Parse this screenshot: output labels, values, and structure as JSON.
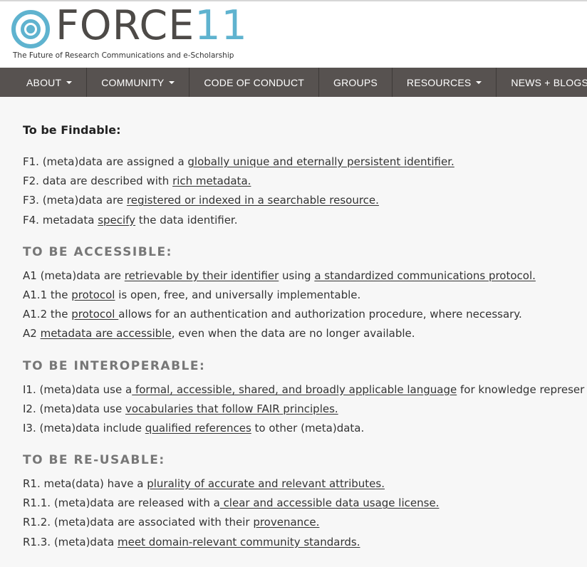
{
  "logo": {
    "word": "FORCE",
    "number": "11",
    "tagline": "The Future of Research Communications and e-Scholarship",
    "colors": {
      "ring": "#5fb3cf",
      "text": "#4d4a47"
    }
  },
  "nav": {
    "background": "#575250",
    "items": [
      {
        "label": "ABOUT",
        "dropdown": true
      },
      {
        "label": "COMMUNITY",
        "dropdown": true
      },
      {
        "label": "CODE OF CONDUCT",
        "dropdown": false
      },
      {
        "label": "GROUPS",
        "dropdown": false
      },
      {
        "label": "RESOURCES",
        "dropdown": true
      },
      {
        "label": "NEWS + BLOGS",
        "dropdown": true
      }
    ]
  },
  "content": {
    "findable": {
      "title": "To be Findable:",
      "lines": [
        {
          "prefix": "F1. (meta)data are assigned a ",
          "link": "globally unique and eternally persistent identifier.",
          "suffix": ""
        },
        {
          "prefix": "F2. data are described with ",
          "link": "rich metadata.",
          "suffix": ""
        },
        {
          "prefix": "F3. (meta)data are ",
          "link": "registered or indexed in a searchable resource.",
          "suffix": ""
        },
        {
          "prefix": "F4. metadata ",
          "link": "specify",
          "suffix": " the data identifier."
        }
      ]
    },
    "accessible": {
      "title": "TO BE ACCESSIBLE:",
      "lines": [
        {
          "prefix": "A1  (meta)data are ",
          "link": "retrievable by their identifier",
          "mid": " using ",
          "link2": "a standardized communications protocol.",
          "suffix": ""
        },
        {
          "prefix": "A1.1 the ",
          "link": "protocol",
          "suffix": " is open, free, and universally implementable."
        },
        {
          "prefix": "A1.2 the ",
          "link": "protocol ",
          "suffix": "allows for an authentication and authorization procedure, where necessary."
        },
        {
          "prefix": "A2 ",
          "link": "metadata are accessible",
          "suffix": ", even when the data are no longer available."
        }
      ]
    },
    "interoperable": {
      "title": "TO BE INTEROPERABLE:",
      "lines": [
        {
          "prefix": "I1. (meta)data use a",
          "link": " formal, accessible, shared, and broadly applicable language",
          "suffix": " for knowledge represer"
        },
        {
          "prefix": "I2. (meta)data use ",
          "link": "vocabularies that follow FAIR principles.",
          "suffix": ""
        },
        {
          "prefix": "I3. (meta)data include ",
          "link": "qualified references",
          "suffix": " to other (meta)data."
        }
      ]
    },
    "reusable": {
      "title": "TO BE RE-USABLE:",
      "lines": [
        {
          "prefix": "R1. meta(data) have a ",
          "link": "plurality of accurate and relevant attributes.",
          "suffix": ""
        },
        {
          "prefix": "R1.1. (meta)data are released with a",
          "link": " clear and accessible data usage license.",
          "suffix": ""
        },
        {
          "prefix": "R1.2. (meta)data are associated with their ",
          "link": "provenance.",
          "suffix": ""
        },
        {
          "prefix": "R1.3. (meta)data ",
          "link": "meet domain-relevant community standards.",
          "suffix": ""
        }
      ]
    }
  }
}
